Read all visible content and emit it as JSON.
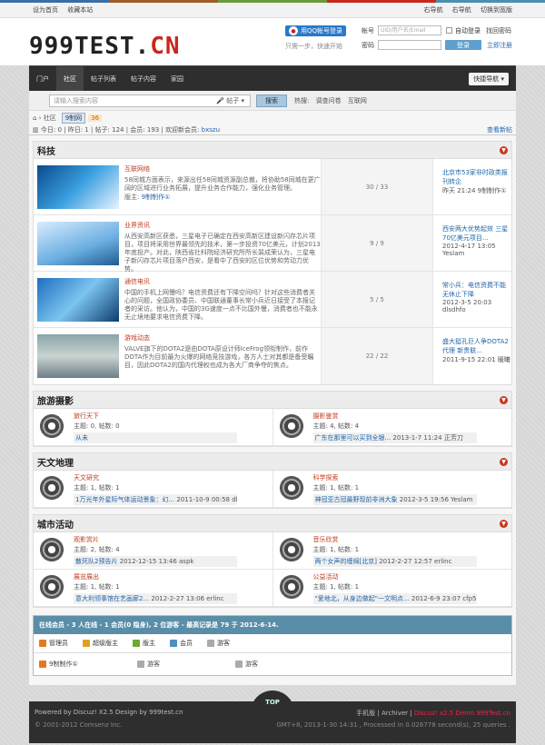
{
  "topbar": {
    "left": [
      "设为首页",
      "收藏本站"
    ],
    "right": [
      "右导航",
      "右导航",
      "切换到宽版"
    ]
  },
  "logo": {
    "main": "999TEST.",
    "accent": "CN"
  },
  "qq": {
    "button": "用QQ帐号登录",
    "tip": "只需一步，快速开始"
  },
  "login": {
    "user_label": "帐号",
    "user_placeholder": "UID/用户名/Email",
    "remember": "自动登录",
    "forgot": "找回密码",
    "pass_label": "密码",
    "submit": "登录",
    "register": "立即注册"
  },
  "nav": {
    "items": [
      "门户",
      "社区",
      "帖子列表",
      "帖子内容",
      "家园"
    ],
    "active": 1,
    "quick": "快捷导航"
  },
  "search": {
    "placeholder": "请输入搜索内容",
    "category": "帖子",
    "button": "搜索",
    "hot_label": "热搜:",
    "hot": [
      "调查问卷",
      "互联网"
    ]
  },
  "crumb": {
    "home": "社区",
    "badge": "9制网",
    "count": "36"
  },
  "stats": {
    "text": "今日: 0 | 昨日: 1 | 帖子: 124 | 会员: 193 | 欢迎新会员:",
    "new_member": "bxszu",
    "latest": "查看新帖"
  },
  "sections": [
    {
      "title": "科技",
      "layout": "list",
      "forums": [
        {
          "name": "互联网络",
          "desc": "58同城方面表示，来源出任58同城资源副总裁，将协助58同城在更广阔的区域进行业务拓展，提升业务合作能力，强化业务管理。",
          "mod": "版主:",
          "mod_name": "9制制作①",
          "count": "30 / 33",
          "last1": "北京市53家非时政类报刊转企",
          "last2": "昨天 21:24 9制制作①"
        },
        {
          "name": "业界资讯",
          "desc": "从西安高新区获悉，三星电子已确定在西安高新区建设新闪存芯片项目，项目将采用世界最领先的技术，第一步投资70亿美元，计划2013年底投产。对此，陕西省社科院经济研究所所长裴成荣认为，三星电子新闪存芯片项目落户西安，是看中了西安的区位优势和劳动力优势。",
          "mod": "",
          "mod_name": "",
          "count": "9 / 9",
          "last1": "西安两大优势起效 三星70亿美元项目...",
          "last2": "2012-4-17 13:05 Yeslam"
        },
        {
          "name": "通信电讯",
          "desc": "中国的手机上网慢吗？电信资费还有下降空间吗？针对这些消费者关心的问题，全国政协委员、中国联通董事长常小兵近日接受了本报记者的采访。他认为，中国的3G速度一点不比国外慢，消费者也不能永无止境地要求电信资费下降。",
          "mod": "",
          "mod_name": "",
          "count": "5 / 5",
          "last1": "常小兵：电信资费不能无休止下降",
          "last2": "2012-3-5 20:03 dlsdhfo"
        },
        {
          "name": "游戏动态",
          "desc": "VALVE旗下的DOTA2是由DOTA原设计师IceFrog领衔制作，前作 DOTA作为目前最为火爆的网络竞技游戏，各方人士对其都是备受瞩目，因此DOTA2的国内代理权也成为各大厂商争夺的焦点。",
          "mod": "",
          "mod_name": "",
          "count": "22 / 22",
          "last1": "盛大挺孔巨人争DOTA2代理 新贵联...",
          "last2": "2011-9-15 22:01 暖曦"
        }
      ]
    },
    {
      "title": "旅游摄影",
      "layout": "grid",
      "forums": [
        {
          "name": "旅行天下",
          "stats": "主题: 0, 帖数: 0",
          "last": "从未",
          "last_meta": ""
        },
        {
          "name": "摄影鉴赏",
          "stats": "主题: 4, 帖数: 4",
          "last": "广东在那里可以买到全银...",
          "last_meta": "2013-1-7 11:24 正芳刀"
        }
      ]
    },
    {
      "title": "天文地理",
      "layout": "grid",
      "forums": [
        {
          "name": "天文研究",
          "stats": "主题: 1, 帖数: 1",
          "last": "1万光年外星际气体运动景象：幻...",
          "last_meta": "2011-10-9 00:58 dlsdhfo"
        },
        {
          "name": "科学探索",
          "stats": "主题: 1, 帖数: 1",
          "last": "神冠亚古冠最野现前非洲大象",
          "last_meta": "2012-3-5 19:56 Yeslam"
        }
      ]
    },
    {
      "title": "城市活动",
      "layout": "grid",
      "forums": [
        {
          "name": "观影赏片",
          "stats": "主题: 2, 帖数: 4",
          "last": "散死队2预告片",
          "last_meta": "2012-12-15 13:46 aspk"
        },
        {
          "name": "音乐欣赏",
          "stats": "主题: 1, 帖数: 1",
          "last": "两个女声的缠绵[北京]",
          "last_meta": "2012-2-27 12:57 erlinc"
        },
        {
          "name": "展览展出",
          "stats": "主题: 1, 帖数: 1",
          "last": "意大利领事馆在艺画廊2...",
          "last_meta": "2012-2-27 13:06 erlinc"
        },
        {
          "name": "公益活动",
          "stats": "主题: 1, 帖数: 1",
          "last": "\"爱地北，从身边做起\"一文明点...",
          "last_meta": "2012-6-9 23:07 cfp520"
        }
      ]
    }
  ],
  "online": {
    "header": "在线会员 - 3 人在线 - 1 会员(0 隐身), 2 位游客 - 最高记录是 79 于 2012-6-14.",
    "legend": [
      "管理员",
      "超级版主",
      "版主",
      "会员",
      "游客"
    ],
    "users": [
      "9制制作①",
      "游客",
      "游客"
    ]
  },
  "footer": {
    "top": "TOP",
    "powered": "Powered by Discuz! X2.5 Design by 999test.cn",
    "links": "手机版 | Archiver |",
    "demo": "Discuz! x2.5 Demo 999Test.cn",
    "copy": "© 2001-2012 Comsenz Inc.",
    "time": "GMT+8, 2013-1-30 14:31 , Processed in 0.026778 second(s), 25 queries ."
  },
  "colors": {
    "accent": "#c8281c",
    "link": "#2266aa",
    "online": "#5a8ea8",
    "stripe": [
      "#3a6ea5",
      "#a05a2c",
      "#6a9a3a",
      "#c8281c",
      "#4b8fb1"
    ]
  }
}
